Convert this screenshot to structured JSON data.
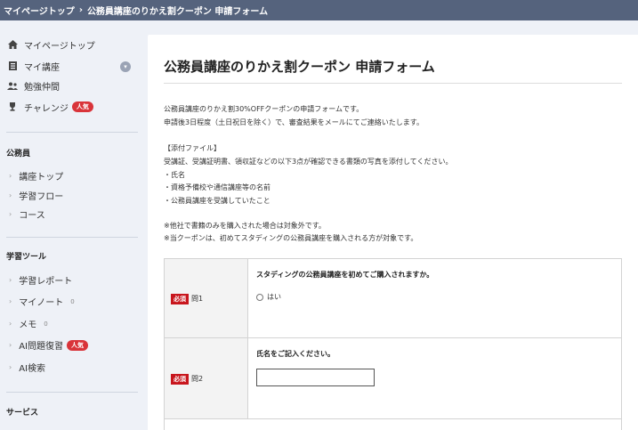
{
  "breadcrumb": {
    "home": "マイページトップ",
    "separator": "›",
    "current": "公務員講座のりかえ割クーポン 申請フォーム"
  },
  "sidebar": {
    "main_items": [
      {
        "label": "マイページトップ",
        "icon": "home-icon"
      },
      {
        "label": "マイ講座",
        "icon": "book-icon"
      },
      {
        "label": "勉強仲間",
        "icon": "people-icon"
      },
      {
        "label": "チャレンジ",
        "icon": "trophy-icon",
        "badge": "人気"
      }
    ],
    "sections": [
      {
        "title": "公務員",
        "items": [
          {
            "label": "講座トップ"
          },
          {
            "label": "学習フロー"
          },
          {
            "label": "コース"
          }
        ]
      },
      {
        "title": "学習ツール",
        "items": [
          {
            "label": "学習レポート"
          },
          {
            "label": "マイノート",
            "count": "0"
          },
          {
            "label": "メモ",
            "count": "0"
          },
          {
            "label": "AI問題復習",
            "badge": "人気"
          },
          {
            "label": "AI検索"
          }
        ]
      },
      {
        "title": "サービス",
        "items": []
      }
    ]
  },
  "form": {
    "title": "公務員講座のりかえ割クーポン 申請フォーム",
    "description": [
      "公務員講座のりかえ割30%OFFクーポンの申請フォームです。",
      "申請後3日程度（土日祝日を除く）で、審査結果をメールにてご連絡いたします。",
      "",
      "【添付ファイル】",
      "受講証、受講証明書、領収証などの以下3点が確認できる書類の写真を添付してください。",
      "・氏名",
      "・資格予備校や通信講座等の名前",
      "・公務員講座を受講していたこと",
      "",
      "※他社で書籍のみを購入された場合は対象外です。",
      "※当クーポンは、初めてスタディングの公務員講座を購入される方が対象です。"
    ],
    "questions": [
      {
        "required": "必須",
        "number": "問1",
        "text": "スタディングの公務員講座を初めてご購入されますか。",
        "option": "はい"
      },
      {
        "required": "必須",
        "number": "問2",
        "text": "氏名をご記入ください。",
        "value": ""
      }
    ]
  }
}
